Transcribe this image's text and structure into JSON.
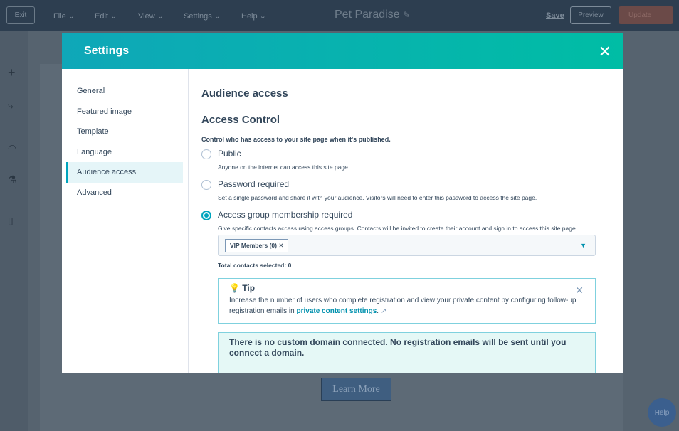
{
  "topbar": {
    "exit": "Exit",
    "menus": [
      "File",
      "Edit",
      "View",
      "Settings",
      "Help"
    ],
    "title": "Pet Paradise",
    "save": "Save",
    "preview": "Preview",
    "update": "Update"
  },
  "page": {
    "learn_more": "Learn More",
    "help": "Help"
  },
  "modal": {
    "title": "Settings",
    "nav": [
      "General",
      "Featured image",
      "Template",
      "Language",
      "Audience access",
      "Advanced"
    ],
    "heading": "Audience access",
    "section": "Access Control",
    "intro": "Control who has access to your site page when it's published.",
    "options": [
      {
        "label": "Public",
        "desc": "Anyone on the internet can access this site page."
      },
      {
        "label": "Password required",
        "desc": "Set a single password and share it with your audience. Visitors will need to enter this password to access the site page."
      },
      {
        "label": "Access group membership required",
        "desc": "Give specific contacts access using access groups. Contacts will be invited to create their account and sign in to access this site page."
      }
    ],
    "selected_option": "Access group membership required",
    "tag": "VIP Members (0)",
    "total": "Total contacts selected: 0",
    "tip": {
      "title": "Tip",
      "text": "Increase the number of users who complete registration and view your private content by configuring follow-up registration emails in ",
      "link": "private content settings",
      "end": "."
    },
    "warning": "There is no custom domain connected. No registration emails will be sent until you connect a domain."
  }
}
